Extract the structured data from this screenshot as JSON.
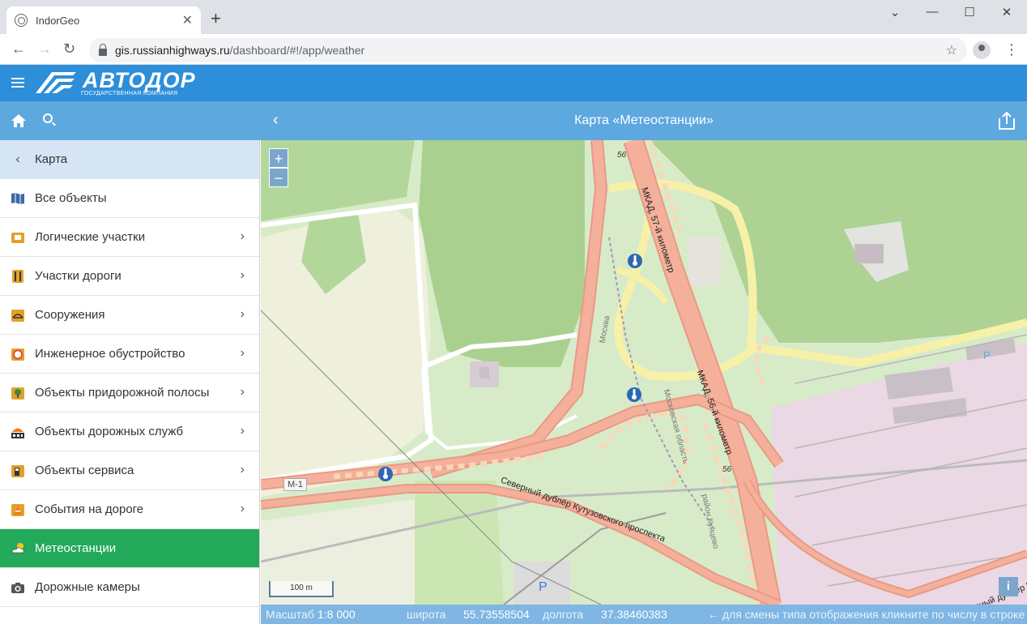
{
  "browser": {
    "tab_title": "IndorGeo",
    "url_host": "gis.russianhighways.ru",
    "url_path": "/dashboard/#!/app/weather"
  },
  "app": {
    "logo_text": "АВТОДОР",
    "logo_sub": "ГОСУДАРСТВЕННАЯ КОМПАНИЯ",
    "page_title": "Карта «Метеостанции»"
  },
  "sidebar": {
    "header_label": "Карта",
    "items": [
      {
        "label": "Все объекты",
        "chevron": false
      },
      {
        "label": "Логические участки",
        "chevron": true
      },
      {
        "label": "Участки дороги",
        "chevron": true
      },
      {
        "label": "Сооружения",
        "chevron": true
      },
      {
        "label": "Инженерное обустройство",
        "chevron": true
      },
      {
        "label": "Объекты придорожной полосы",
        "chevron": true
      },
      {
        "label": "Объекты дорожных служб",
        "chevron": true
      },
      {
        "label": "Объекты сервиса",
        "chevron": true
      },
      {
        "label": "События на дороге",
        "chevron": true
      },
      {
        "label": "Метеостанции",
        "chevron": false,
        "active": true
      },
      {
        "label": "Дорожные камеры",
        "chevron": false
      }
    ]
  },
  "map": {
    "zoom_in": "+",
    "zoom_out": "−",
    "scale_label": "100 m",
    "info": "i",
    "labels": {
      "mkad57": "МКАД, 57-й километр",
      "mkad56": "МКАД, 56-й километр",
      "km56a": "56",
      "km56b": "56",
      "m1": "М-1",
      "dubler": "Северный дублёр Кутузовского проспекта",
      "dubler2": "Северный дублер Кутузовского проспекта",
      "moskva": "Москва",
      "mosobl": "Московская область",
      "kuntsevo": "район Кунцево"
    }
  },
  "status": {
    "scale_label": "Масштаб",
    "scale_value": "1:8 000",
    "lat_label": "широта",
    "lat_value": "55.73558504",
    "lon_label": "долгота",
    "lon_value": "37.38460383",
    "hint": "← для смены типа отображения кликните по числу в строке"
  },
  "colors": {
    "header": "#2d8ed9",
    "subheader": "#5ea8e0",
    "active": "#23a95a",
    "statusbar": "#7fb6e3"
  }
}
